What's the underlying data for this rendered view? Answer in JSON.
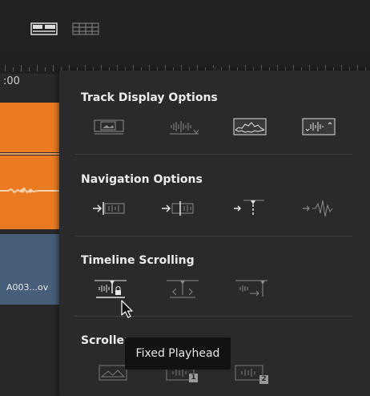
{
  "timeline": {
    "timecode": ":00",
    "clip_label": "A003...ov"
  },
  "panel": {
    "sections": [
      {
        "title": "Track Display Options"
      },
      {
        "title": "Navigation Options"
      },
      {
        "title": "Timeline Scrolling"
      },
      {
        "title": "Scroller"
      }
    ]
  },
  "tooltip": {
    "text": "Fixed Playhead"
  },
  "icons": {
    "view_card": "card-view-icon",
    "view_list": "list-view-icon"
  },
  "colors": {
    "accent_orange": "#ea7b22",
    "panel_bg": "#2a2a2c",
    "tooltip_bg": "#121212"
  }
}
